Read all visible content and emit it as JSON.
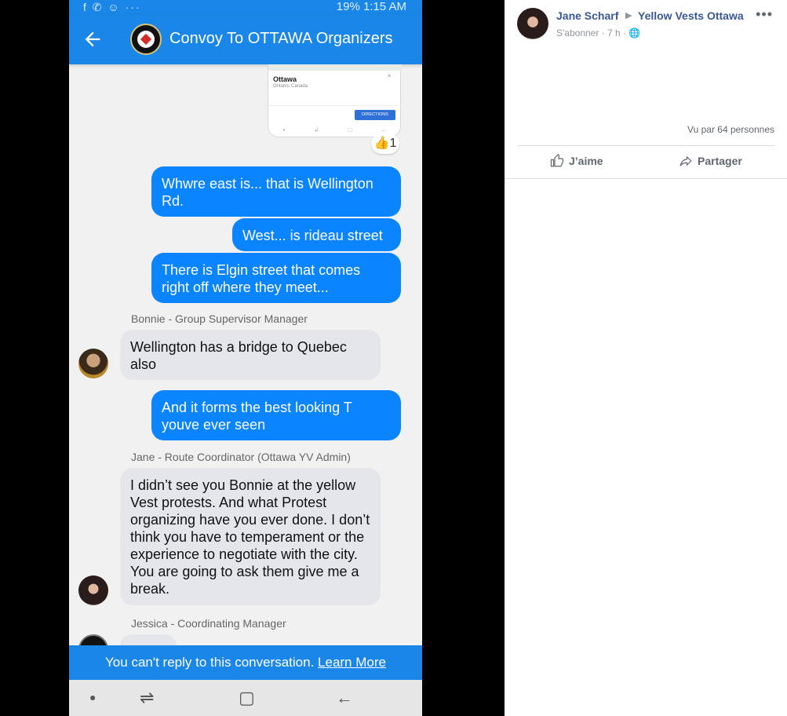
{
  "phone": {
    "status": {
      "left_icons": "f ✆ ☺ ···",
      "right_text": "19% 1:15 AM"
    },
    "header": {
      "title": "Convoy To OTTAWA Organizers"
    },
    "map_card": {
      "city": "Ottawa",
      "country": "Ontario, Canada",
      "directions_label": "DIRECTIONS",
      "reaction_emoji": "👍",
      "reaction_count": "1"
    },
    "messages": [
      {
        "type": "outgoing",
        "text": "Whwre east is... that is Wellington Rd."
      },
      {
        "type": "outgoing",
        "text": "West... is rideau street"
      },
      {
        "type": "outgoing",
        "text": "There is Elgin street that comes right off where they meet..."
      },
      {
        "type": "incoming",
        "sender": "Bonnie - Group Supervisor Manager",
        "text": "Wellington has a bridge to Quebec also"
      },
      {
        "type": "outgoing",
        "text": "And it forms the best looking T youve ever seen"
      },
      {
        "type": "incoming",
        "sender": "Jane - Route Coordinator (Ottawa YV Admin)",
        "text": "I didn’t see you Bonnie at the yellow Vest protests. And what Protest organizing have you ever done. I don’t think you have to temperament or the experience to negotiate with the city. You are going to ask them give me a break."
      },
      {
        "type": "incoming",
        "sender": "Jessica - Coordinating Manager",
        "text": ""
      }
    ],
    "reply_bar": {
      "text": "You can't reply to this conversation. ",
      "link": "Learn More"
    }
  },
  "post": {
    "author": "Jane Scharf",
    "group": "Yellow Vests Ottawa",
    "follow_label": "S'abonner",
    "time": "7 h",
    "views": "Vu par 64 personnes",
    "like_label": "J’aime",
    "share_label": "Partager"
  },
  "colors": {
    "messenger_blue": "#1a86e8",
    "bubble_blue": "#0a84ff",
    "fb_link": "#385898"
  }
}
